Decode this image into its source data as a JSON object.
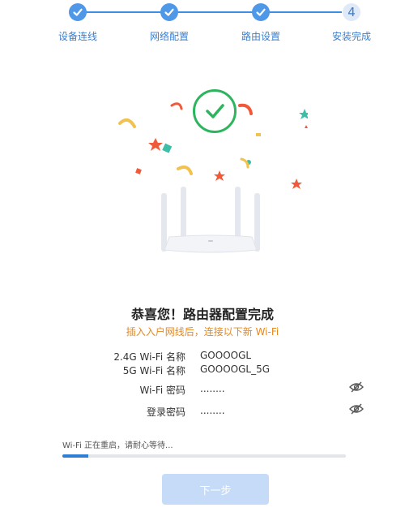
{
  "stepper": {
    "steps": [
      {
        "label": "设备连线",
        "state": "done",
        "icon": "check-icon"
      },
      {
        "label": "网络配置",
        "state": "done",
        "icon": "check-icon"
      },
      {
        "label": "路由设置",
        "state": "done",
        "icon": "check-icon"
      },
      {
        "label": "安装完成",
        "state": "current",
        "number": "4"
      }
    ],
    "accent_color": "#3d8fe6"
  },
  "illustration": {
    "icon": "success-check-icon",
    "image": "router-illustration",
    "check_color": "#2db55d"
  },
  "main": {
    "title": "恭喜您！路由器配置完成",
    "subtitle": "插入入户网线后，连接以下新 Wi-Fi",
    "subtitle_color": "#e6871f",
    "info": [
      {
        "label": "2.4G Wi-Fi 名称",
        "value": "GOOOOGL"
      },
      {
        "label": "5G Wi-Fi 名称",
        "value": "GOOOOGL_5G"
      },
      {
        "label": "Wi-Fi 密码",
        "value": "........",
        "icon": "eye-hidden-icon"
      },
      {
        "label": "登录密码",
        "value": "........",
        "icon": "eye-hidden-icon"
      }
    ]
  },
  "progress": {
    "text": "Wi-Fi 正在重启，请耐心等待...",
    "percent": 9,
    "fill_color": "#2e7ed6"
  },
  "footer": {
    "next_label": "下一步",
    "button_color": "#c5dbf7"
  }
}
